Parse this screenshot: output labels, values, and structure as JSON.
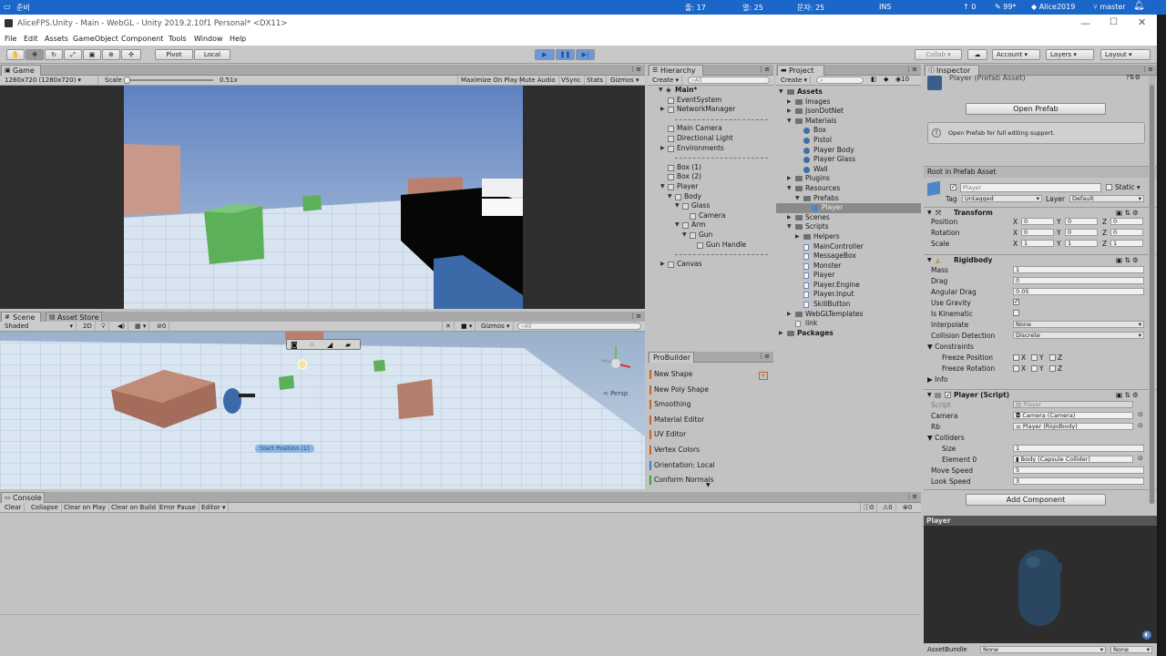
{
  "os_bar": {
    "left_label": "준비",
    "s1": "줄: 17",
    "s2": "열: 25",
    "s3": "문자: 25",
    "mode": "INS",
    "up": "0",
    "zoom": "99*",
    "user": "Alice2019",
    "branch": "master"
  },
  "window": {
    "title": "AliceFPS.Unity - Main - WebGL - Unity 2019.2.10f1 Personal* <DX11>"
  },
  "menu": [
    "File",
    "Edit",
    "Assets",
    "GameObject",
    "Component",
    "Tools",
    "Window",
    "Help"
  ],
  "toolbar": {
    "pivot": "Pivot",
    "local": "Local",
    "collab": "Collab ▾",
    "account": "Account",
    "layers": "Layers",
    "layout": "Layout"
  },
  "game": {
    "tab": "Game",
    "resolution": "1280x720 (1280x720)",
    "scale_label": "Scale",
    "scale_value": "0.51x",
    "buttons": [
      "Maximize On Play",
      "Mute Audio",
      "VSync",
      "Stats",
      "Gizmos"
    ]
  },
  "scene": {
    "tab": "Scene",
    "asset_store_tab": "Asset Store",
    "shading": "Shaded",
    "mode2d": "2D",
    "fx_count": "0",
    "gizmos": "Gizmos",
    "search_placeholder": "All",
    "persp": "< Persp",
    "start_label": "Start Position (1)"
  },
  "hierarchy": {
    "tab": "Hierarchy",
    "create": "Create",
    "search_placeholder": "All",
    "scene": "Main*",
    "items": [
      {
        "label": "EventSystem",
        "depth": 1
      },
      {
        "label": "NetworkManager",
        "depth": 1,
        "arrow": "▶"
      },
      {
        "label": "",
        "depth": 1,
        "divider": true
      },
      {
        "label": "Main Camera",
        "depth": 1
      },
      {
        "label": "Directional Light",
        "depth": 1
      },
      {
        "label": "Environments",
        "depth": 1,
        "arrow": "▶"
      },
      {
        "label": "",
        "depth": 1,
        "divider": true
      },
      {
        "label": "Box (1)",
        "depth": 1
      },
      {
        "label": "Box (2)",
        "depth": 1
      },
      {
        "label": "Player",
        "depth": 1,
        "arrow": "▼"
      },
      {
        "label": "Body",
        "depth": 2,
        "arrow": "▼"
      },
      {
        "label": "Glass",
        "depth": 3,
        "arrow": "▼"
      },
      {
        "label": "Camera",
        "depth": 4
      },
      {
        "label": "Arm",
        "depth": 3,
        "arrow": "▼"
      },
      {
        "label": "Gun",
        "depth": 4,
        "arrow": "▼"
      },
      {
        "label": "Gun Handle",
        "depth": 5
      },
      {
        "label": "",
        "depth": 1,
        "divider": true
      },
      {
        "label": "Canvas",
        "depth": 1,
        "arrow": "▶"
      }
    ]
  },
  "project": {
    "tab": "Project",
    "create": "Create",
    "count": "10",
    "items": [
      {
        "label": "Assets",
        "depth": 0,
        "arrow": "▼",
        "bold": true
      },
      {
        "label": "Images",
        "depth": 1,
        "arrow": "▶"
      },
      {
        "label": "JsonDotNet",
        "depth": 1,
        "arrow": "▶"
      },
      {
        "label": "Materials",
        "depth": 1,
        "arrow": "▼"
      },
      {
        "label": "Box",
        "depth": 2,
        "mat": true
      },
      {
        "label": "Pistol",
        "depth": 2,
        "mat": true
      },
      {
        "label": "Player Body",
        "depth": 2,
        "mat": true
      },
      {
        "label": "Player Glass",
        "depth": 2,
        "mat": true
      },
      {
        "label": "Wall",
        "depth": 2,
        "mat": true
      },
      {
        "label": "Plugins",
        "depth": 1,
        "arrow": "▶"
      },
      {
        "label": "Resources",
        "depth": 1,
        "arrow": "▼"
      },
      {
        "label": "Prefabs",
        "depth": 2,
        "arrow": "▼"
      },
      {
        "label": "Player",
        "depth": 3,
        "selected": true
      },
      {
        "label": "Scenes",
        "depth": 1,
        "arrow": "▶"
      },
      {
        "label": "Scripts",
        "depth": 1,
        "arrow": "▼"
      },
      {
        "label": "Helpers",
        "depth": 2,
        "arrow": "▶"
      },
      {
        "label": "MainController",
        "depth": 2,
        "script": true
      },
      {
        "label": "MessageBox",
        "depth": 2,
        "script": true
      },
      {
        "label": "Monster",
        "depth": 2,
        "script": true
      },
      {
        "label": "Player",
        "depth": 2,
        "script": true
      },
      {
        "label": "Player.Engine",
        "depth": 2,
        "script": true
      },
      {
        "label": "Player.Input",
        "depth": 2,
        "script": true
      },
      {
        "label": "SkillButton",
        "depth": 2,
        "script": true
      },
      {
        "label": "WebGLTemplates",
        "depth": 1,
        "arrow": "▶"
      },
      {
        "label": "link",
        "depth": 1
      },
      {
        "label": "Packages",
        "depth": 0,
        "arrow": "▶",
        "bold": true
      }
    ]
  },
  "probuilder": {
    "tab": "ProBuilder",
    "items": [
      {
        "label": "New Shape",
        "color": "#c0662a"
      },
      {
        "label": "New Poly Shape",
        "color": "#c0662a"
      },
      {
        "label": "Smoothing",
        "color": "#c0662a"
      },
      {
        "label": "Material Editor",
        "color": "#c0662a"
      },
      {
        "label": "UV Editor",
        "color": "#c0662a"
      },
      {
        "label": "Vertex Colors",
        "color": "#c0662a"
      },
      {
        "label": "Orientation: Local",
        "color": "#2a8ac0"
      },
      {
        "label": "Conform Normals",
        "color": "#3aa040"
      }
    ]
  },
  "inspector": {
    "tab": "Inspector",
    "asset_title": "Player (Prefab Asset)",
    "open_prefab": "Open Prefab",
    "info": "Open Prefab for full editing support.",
    "root": "Root in Prefab Asset",
    "name": "Player",
    "static": "Static",
    "tag_label": "Tag",
    "tag": "Untagged",
    "layer_label": "Layer",
    "layer": "Default",
    "transform": {
      "title": "Transform",
      "rows": [
        {
          "label": "Position",
          "x": "0",
          "y": "0",
          "z": "0"
        },
        {
          "label": "Rotation",
          "x": "0",
          "y": "0",
          "z": "0"
        },
        {
          "label": "Scale",
          "x": "1",
          "y": "1",
          "z": "1"
        }
      ]
    },
    "rigidbody": {
      "title": "Rigidbody",
      "mass_label": "Mass",
      "mass": "1",
      "drag_label": "Drag",
      "drag": "0",
      "adrag_label": "Angular Drag",
      "adrag": "0.05",
      "gravity_label": "Use Gravity",
      "kin_label": "Is Kinematic",
      "interp_label": "Interpolate",
      "interp": "None",
      "coll_label": "Collision Detection",
      "coll": "Discrete",
      "constraints": "Constraints",
      "freeze_pos": "Freeze Position",
      "freeze_rot": "Freeze Rotation",
      "info": "Info"
    },
    "script": {
      "title": "Player (Script)",
      "script_label": "Script",
      "script": "Player",
      "camera_label": "Camera",
      "camera": "Camera (Camera)",
      "rb_label": "Rb",
      "rb": "Player (Rigidbody)",
      "colliders": "Colliders",
      "size_label": "Size",
      "size": "1",
      "el_label": "Element 0",
      "el": "Body (Capsule Collider)",
      "move_label": "Move Speed",
      "move": "5",
      "look_label": "Look Speed",
      "look": "3"
    },
    "add_component": "Add Component",
    "preview_title": "Player",
    "assetbundle_label": "AssetBundle",
    "assetbundle": "None",
    "assetbundle2": "None"
  },
  "console": {
    "tab": "Console",
    "buttons": [
      "Clear",
      "Collapse",
      "Clear on Play",
      "Clear on Build",
      "Error Pause",
      "Editor ▾"
    ],
    "c1": "0",
    "c2": "0",
    "c3": "0"
  }
}
